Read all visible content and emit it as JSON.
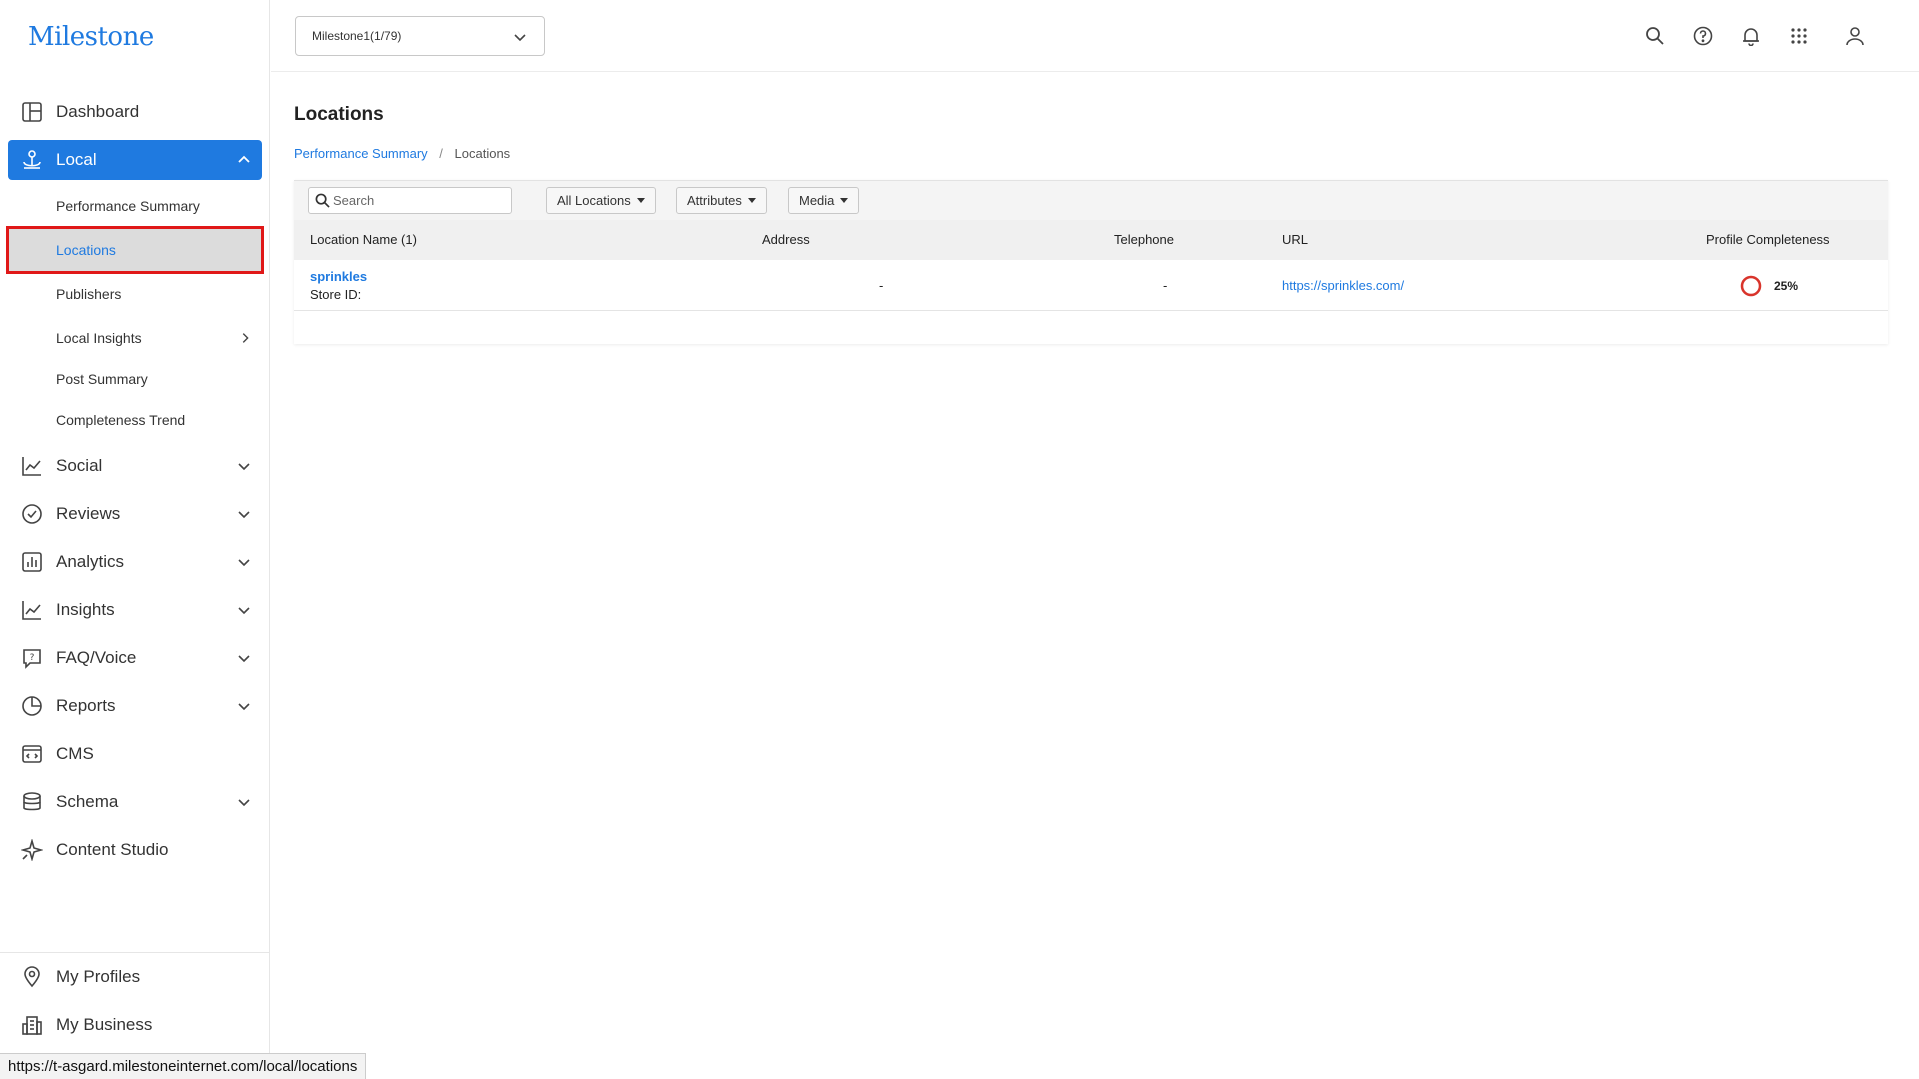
{
  "brand": {
    "logo_text": "Milestone",
    "accent": "#1f7ae0",
    "highlight_border": "#e01818"
  },
  "sidebar": {
    "items": [
      {
        "label": "Dashboard",
        "icon": "dashboard-icon"
      },
      {
        "label": "Local",
        "icon": "local-icon",
        "expanded": true
      },
      {
        "label": "Social",
        "icon": "social-icon"
      },
      {
        "label": "Reviews",
        "icon": "reviews-icon"
      },
      {
        "label": "Analytics",
        "icon": "analytics-icon"
      },
      {
        "label": "Insights",
        "icon": "insights-icon"
      },
      {
        "label": "FAQ/Voice",
        "icon": "faq-icon"
      },
      {
        "label": "Reports",
        "icon": "reports-icon"
      },
      {
        "label": "CMS",
        "icon": "cms-icon"
      },
      {
        "label": "Schema",
        "icon": "schema-icon"
      },
      {
        "label": "Content Studio",
        "icon": "content-studio-icon"
      }
    ],
    "local_subitems": [
      {
        "label": "Performance Summary"
      },
      {
        "label": "Locations",
        "selected": true
      },
      {
        "label": "Publishers"
      },
      {
        "label": "Local Insights"
      },
      {
        "label": "Post Summary"
      },
      {
        "label": "Completeness Trend"
      }
    ],
    "bottom_items": [
      {
        "label": "My Profiles",
        "icon": "location-pin-icon"
      },
      {
        "label": "My Business",
        "icon": "building-icon"
      }
    ]
  },
  "topbar": {
    "account_selector": "Milestone1(1/79)",
    "icons": [
      "search-icon",
      "help-icon",
      "bell-icon",
      "apps-grid-icon",
      "user-icon"
    ]
  },
  "page": {
    "title": "Locations",
    "breadcrumb": {
      "parent": "Performance Summary",
      "separator": "/",
      "current": "Locations"
    }
  },
  "toolbar": {
    "search_placeholder": "Search",
    "all_locations": "All Locations",
    "attributes": "Attributes",
    "media": "Media"
  },
  "table": {
    "columns": [
      "Location Name (1)",
      "Address",
      "Telephone",
      "URL",
      "Profile Completeness"
    ],
    "rows": [
      {
        "name": "sprinkles",
        "store_id": "Store ID:",
        "address": "-",
        "telephone": "-",
        "url": "https://sprinkles.com/",
        "completeness": "25%",
        "completeness_fraction": 0.25
      }
    ]
  },
  "status_bar": {
    "url": "https://t-asgard.milestoneinternet.com/local/locations"
  }
}
